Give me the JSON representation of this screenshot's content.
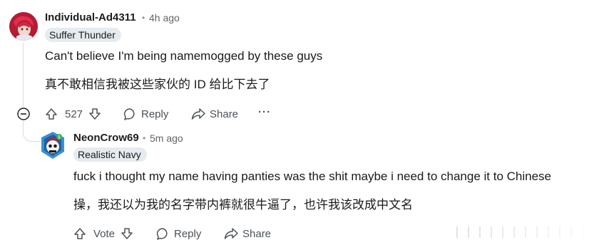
{
  "comment1": {
    "username": "Individual-Ad4311",
    "separator": "•",
    "time": "4h ago",
    "flair": "Suffer Thunder",
    "text_line1": "Can't believe I'm being namemogged by these guys",
    "text_line2": "真不敢相信我被这些家伙的 ID 给比下去了",
    "vote_count": "527",
    "reply_label": "Reply",
    "share_label": "Share",
    "more_label": "···"
  },
  "comment2": {
    "username": "NeonCrow69",
    "separator": "•",
    "time": "5m ago",
    "flair": "Realistic Navy",
    "text_line1": "fuck i thought my name having panties was the shit maybe i need to change it to Chinese",
    "text_line2": "操，我还以为我的名字带内裤就很牛逼了，也许我该改成中文名",
    "vote_label": "Vote",
    "reply_label": "Reply",
    "share_label": "Share"
  },
  "colors": {
    "flair_bg": "#e5ebee",
    "meta_text": "#5f6568",
    "thread_line": "#d7dde0",
    "avatar1_bg": "#c8203a",
    "avatar2_bg": "#3a8fd6"
  },
  "icons": [
    "avatar",
    "collapse-icon",
    "upvote-icon",
    "downvote-icon",
    "reply-bubble-icon",
    "share-arrow-icon",
    "more-icon"
  ]
}
